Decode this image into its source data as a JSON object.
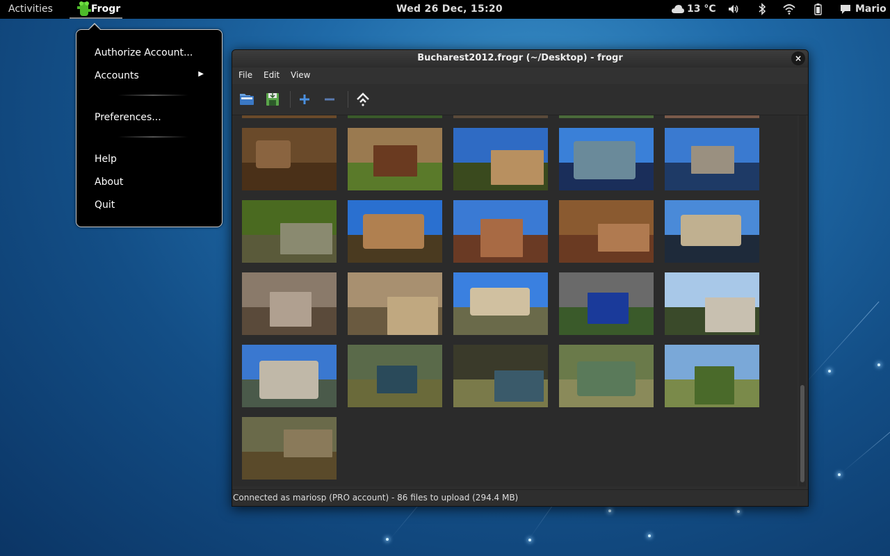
{
  "topbar": {
    "activities": "Activities",
    "app_name": "Frogr",
    "clock": "Wed 26 Dec, 15:20",
    "weather": "13 °C",
    "user": "Mario",
    "icons": [
      "weather-cloud-icon",
      "volume-icon",
      "bluetooth-icon",
      "wifi-icon",
      "battery-icon",
      "chat-icon"
    ]
  },
  "app_menu": {
    "items": [
      "Authorize Account...",
      "Accounts",
      "Preferences...",
      "Help",
      "About",
      "Quit"
    ],
    "submenu_arrow": "▶"
  },
  "window": {
    "title": "Bucharest2012.frogr (~/Desktop) - frogr",
    "close": "×",
    "menus": [
      "File",
      "Edit",
      "View"
    ],
    "toolbar_icons": [
      "open-icon",
      "save-icon",
      "add-icon",
      "remove-icon",
      "upload-icon"
    ],
    "status": "Connected as mariosp (PRO account) - 86 files to upload (294.4 MB)"
  },
  "thumbnails": [
    {
      "sky": "#6a4a2a",
      "ground": "#4a3018",
      "obj": "#8a6440"
    },
    {
      "sky": "#9a7a50",
      "ground": "#5a7a2a",
      "obj": "#6a3a20"
    },
    {
      "sky": "#2f6bc4",
      "ground": "#3a4a1e",
      "obj": "#b89060"
    },
    {
      "sky": "#3a80d8",
      "ground": "#1a2e5a",
      "obj": "#6a8a9a"
    },
    {
      "sky": "#3a7ad0",
      "ground": "#1e3a66",
      "obj": "#9a9080"
    },
    {
      "sky": "#4a6a20",
      "ground": "#5a5a3a",
      "obj": "#8a8a70"
    },
    {
      "sky": "#2a70d0",
      "ground": "#4a3a20",
      "obj": "#b08050"
    },
    {
      "sky": "#3a7ad4",
      "ground": "#6a3a24",
      "obj": "#a86a44"
    },
    {
      "sky": "#8a5a30",
      "ground": "#6a3a22",
      "obj": "#b07a50"
    },
    {
      "sky": "#4a8ad8",
      "ground": "#1e2a3a",
      "obj": "#c0b090"
    },
    {
      "sky": "#8a7a6a",
      "ground": "#5a4a3a",
      "obj": "#b0a090"
    },
    {
      "sky": "#a89070",
      "ground": "#6a5a40",
      "obj": "#c0a880"
    },
    {
      "sky": "#3a80e0",
      "ground": "#6a6a4a",
      "obj": "#d0c0a0"
    },
    {
      "sky": "#6a6a6a",
      "ground": "#3a5a2a",
      "obj": "#1a3a9a"
    },
    {
      "sky": "#a8c8e8",
      "ground": "#3a4a2a",
      "obj": "#c8c0b0"
    },
    {
      "sky": "#3a78d0",
      "ground": "#4a5a4a",
      "obj": "#c0b8a8"
    },
    {
      "sky": "#5a6a4a",
      "ground": "#6a6a3a",
      "obj": "#2a4a5a"
    },
    {
      "sky": "#3a3a2a",
      "ground": "#7a7a4a",
      "obj": "#3a5a6a"
    },
    {
      "sky": "#6a7a4a",
      "ground": "#8a8a5a",
      "obj": "#5a7a5a"
    },
    {
      "sky": "#7aa8d8",
      "ground": "#7a8a4a",
      "obj": "#4a6a2a"
    },
    {
      "sky": "#6a6a4a",
      "ground": "#5a4a2a",
      "obj": "#8a7a5a"
    }
  ]
}
